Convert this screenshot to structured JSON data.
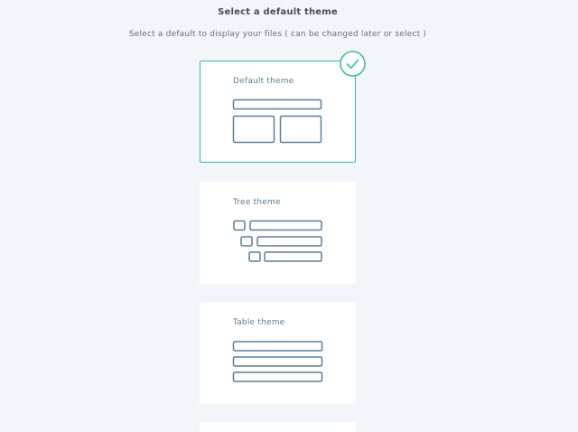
{
  "header": {
    "title": "Select a default theme",
    "subtitle": "Select a default to display your files ( can be changed later or select )"
  },
  "themes": [
    {
      "label": "Default theme",
      "selected": true
    },
    {
      "label": "Tree theme",
      "selected": false
    },
    {
      "label": "Table theme",
      "selected": false
    }
  ],
  "colors": {
    "background": "#f2f5f9",
    "card": "#ffffff",
    "accent": "#35c08a",
    "preview_stroke": "#5b7f97",
    "label": "#5d7d97"
  },
  "icons": {
    "selected_indicator": "checkmark-icon"
  }
}
